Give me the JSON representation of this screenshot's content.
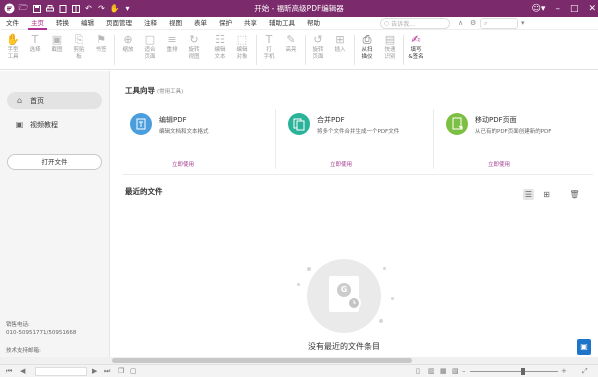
{
  "window": {
    "title": "开始 - 福昕高级PDF编辑器"
  },
  "menu": {
    "tabs": [
      "文件",
      "主页",
      "转换",
      "编辑",
      "页面管理",
      "注释",
      "视图",
      "表单",
      "保护",
      "共享",
      "辅助工具",
      "帮助"
    ],
    "active": "主页",
    "search_placeholder": "告诉我..."
  },
  "ribbon": {
    "hand_tool": "手型\n工具",
    "select": "选择",
    "screenshot": "截图",
    "clipboard": "剪贴\n板",
    "bookmark": "书签",
    "zoom": "缩放",
    "fit_page": "适合\n页面",
    "reflow": "重排",
    "rotate_view": "旋转\n视图",
    "edit_text": "编辑\n文本",
    "edit_object": "编辑\n对象",
    "typewriter": "打\n字机",
    "highlight": "高亮",
    "rotate_page": "旋转\n页面",
    "insert": "插入",
    "from_scanner": "从扫\n描仪",
    "quick_ocr": "快速\n识别",
    "fill_sign": "填写\n&签名"
  },
  "sidebar": {
    "items": [
      {
        "label": "首页",
        "icon": "home-icon",
        "active": true
      },
      {
        "label": "视频教程",
        "icon": "video-icon",
        "active": false
      }
    ],
    "open_file": "打开文件",
    "contact_label": "销售电话:",
    "contact_phone": "010-50951771/50951668",
    "support_label": "技术支持邮箱:"
  },
  "main": {
    "tools_title": "工具向导",
    "tools_hint": "(常用工具)",
    "tools": [
      {
        "title": "编辑PDF",
        "desc": "编辑文档和文本格式",
        "action": "立即使用",
        "color": "#4b9ede",
        "icon": "edit-pdf-icon"
      },
      {
        "title": "合并PDF",
        "desc": "将多个文件合并生成一个PDF文件",
        "action": "立即使用",
        "color": "#2bb39a",
        "icon": "merge-pdf-icon"
      },
      {
        "title": "移动PDF页面",
        "desc": "从已有的PDF页面创建新的PDF",
        "action": "立即使用",
        "color": "#7cc043",
        "icon": "move-pages-icon"
      }
    ],
    "recent_title": "最近的文件",
    "empty_text": "没有最近的文件条目"
  },
  "colors": {
    "titlebar": "#7b2a6b",
    "accent": "#b02f8f"
  }
}
